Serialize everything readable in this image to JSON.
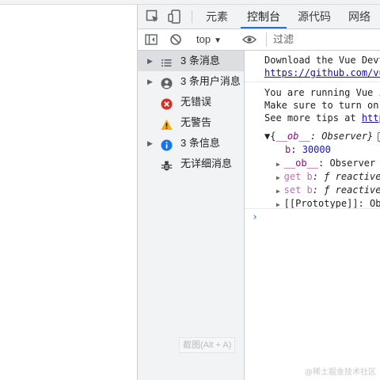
{
  "devtools": {
    "tabs": [
      "元素",
      "控制台",
      "源代码",
      "网络"
    ],
    "active_tab": "控制台",
    "icons": [
      "inspect-element-icon",
      "device-toolbar-icon"
    ]
  },
  "console_toolbar": {
    "context": "top",
    "filter_placeholder": "过滤",
    "icons": [
      "sidebar-toggle-icon",
      "clear-console-icon",
      "live-expression-eye-icon"
    ]
  },
  "sidebar": {
    "items": [
      {
        "label": "3 条消息",
        "icon": "list-icon",
        "expandable": true,
        "selected": true
      },
      {
        "label": "3 条用户消息",
        "icon": "user-icon",
        "expandable": true,
        "selected": false
      },
      {
        "label": "无错误",
        "icon": "error-icon",
        "expandable": false,
        "selected": false
      },
      {
        "label": "无警告",
        "icon": "warning-icon",
        "expandable": false,
        "selected": false
      },
      {
        "label": "3 条信息",
        "icon": "info-icon",
        "expandable": true,
        "selected": false
      },
      {
        "label": "无详细消息",
        "icon": "bug-icon",
        "expandable": false,
        "selected": false
      }
    ],
    "tooltip": "截图(Alt + A)"
  },
  "console": {
    "messages": [
      {
        "lines": [
          "Download the Vue Devt",
          "https://github.com/vu"
        ]
      },
      {
        "lines": [
          "You are running Vue i",
          "Make sure to turn on",
          "See more tips at http"
        ]
      }
    ],
    "object": {
      "summary_open": "▼{",
      "summary_key": "__ob__",
      "summary_rest": ": Observer}",
      "prop_b_key": "b",
      "prop_b_value": "30000",
      "ob_key": "__ob__",
      "ob_value": ": Observer {",
      "getter_prefix": "get b",
      "getter_value": ": ƒ reactiveG",
      "setter_prefix": "set b",
      "setter_value": ": ƒ reactiveS",
      "proto": "[[Prototype]]: Obj"
    },
    "prompt": "›"
  },
  "watermark": "@稀土掘金技术社区",
  "colors": {
    "accent": "#1a73e8",
    "error": "#d93025",
    "warning": "#f9ab00",
    "info": "#1a73e8",
    "purple_key": "#881280",
    "number": "#1a1aa6"
  }
}
